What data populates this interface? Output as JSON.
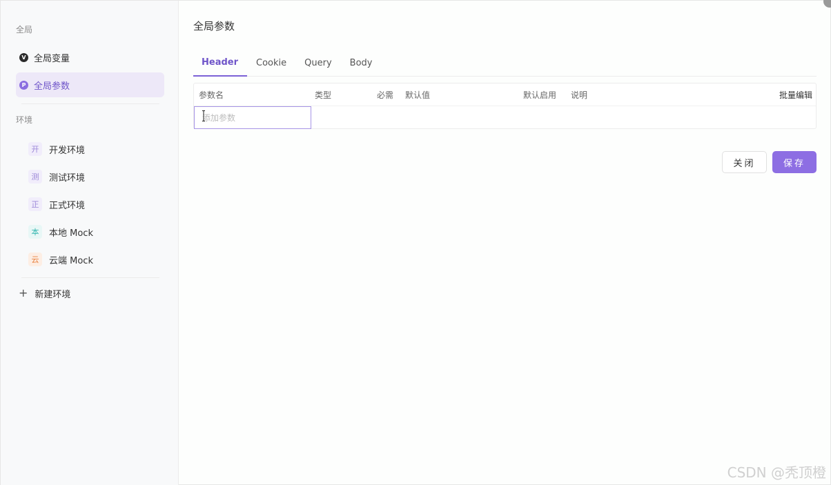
{
  "sidebar": {
    "section_global": "全局",
    "global_vars": "全局变量",
    "global_vars_icon": "V",
    "global_params": "全局参数",
    "global_params_icon": "P",
    "section_env": "环境",
    "envs": [
      {
        "badge": "开",
        "label": "开发环境",
        "color": "#9b86d8",
        "bg": "#f1edfb"
      },
      {
        "badge": "测",
        "label": "测试环境",
        "color": "#9b86d8",
        "bg": "#f1edfb"
      },
      {
        "badge": "正",
        "label": "正式环境",
        "color": "#9b86d8",
        "bg": "#f1edfb"
      },
      {
        "badge": "本",
        "label": "本地 Mock",
        "color": "#35b7b0",
        "bg": "#e8f7f6"
      },
      {
        "badge": "云",
        "label": "云端 Mock",
        "color": "#e8803e",
        "bg": "#fdeee4"
      }
    ],
    "new_env": "新建环境",
    "new_env_icon": "plus-icon"
  },
  "main": {
    "title": "全局参数",
    "tabs": [
      {
        "label": "Header",
        "active": true
      },
      {
        "label": "Cookie",
        "active": false
      },
      {
        "label": "Query",
        "active": false
      },
      {
        "label": "Body",
        "active": false
      }
    ],
    "table": {
      "columns": [
        "参数名",
        "类型",
        "必需",
        "默认值",
        "默认启用",
        "说明"
      ],
      "bulk_edit": "批量编辑",
      "input_placeholder": "添加参数",
      "input_value": ""
    },
    "buttons": {
      "close": "关闭",
      "save": "保存"
    }
  },
  "watermark": "CSDN @秃顶橙",
  "colors": {
    "accent": "#7b61d6",
    "save_bg": "#8d6ee3",
    "active_item_bg": "#ede8f8"
  }
}
